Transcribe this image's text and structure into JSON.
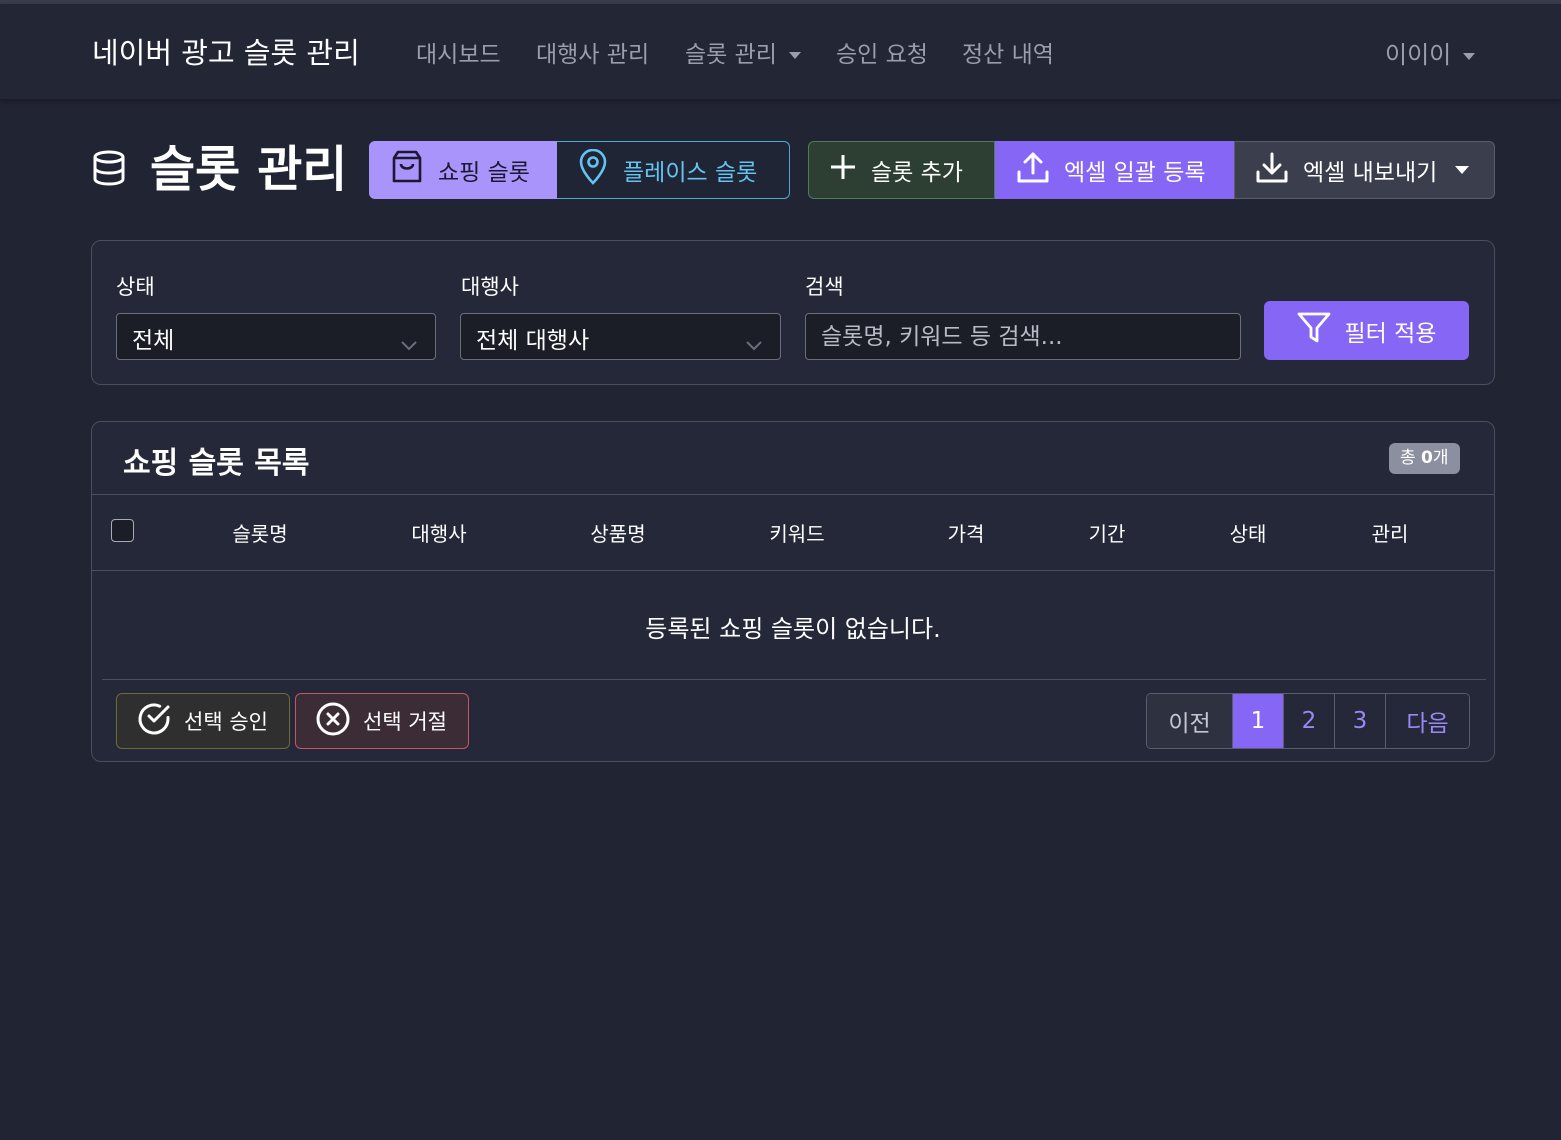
{
  "navbar": {
    "brand": "네이버 광고 슬롯 관리",
    "items": [
      "대시보드",
      "대행사 관리",
      "슬롯 관리",
      "승인 요청",
      "정산 내역"
    ],
    "user": "이이이"
  },
  "page": {
    "title": "슬롯 관리",
    "tabs": {
      "shopping": "쇼핑 슬롯",
      "place": "플레이스 슬롯"
    },
    "actions": {
      "add": "슬롯 추가",
      "excel_upload": "엑셀 일괄 등록",
      "excel_export": "엑셀 내보내기"
    }
  },
  "filters": {
    "status_label": "상태",
    "status_value": "전체",
    "agency_label": "대행사",
    "agency_value": "전체 대행사",
    "search_label": "검색",
    "search_placeholder": "슬롯명, 키워드 등 검색...",
    "apply": "필터 적용"
  },
  "list": {
    "title": "쇼핑 슬롯 목록",
    "count_prefix": "총 ",
    "count_value": "0",
    "count_suffix": "개",
    "columns": [
      "슬롯명",
      "대행사",
      "상품명",
      "키워드",
      "가격",
      "기간",
      "상태",
      "관리"
    ],
    "empty_message": "등록된 쇼핑 슬롯이 없습니다.",
    "bulk_approve": "선택 승인",
    "bulk_reject": "선택 거절"
  },
  "pagination": {
    "prev": "이전",
    "pages": [
      "1",
      "2",
      "3"
    ],
    "current": "1",
    "next": "다음"
  },
  "colors": {
    "background": "#212433",
    "primary": "#8667f5",
    "shopping_tab": "#a994fc",
    "place_tab": "#64c4ef",
    "approve_border": "#6d6a3b",
    "reject_border": "#c15863"
  },
  "icons": {
    "title": "database-icon",
    "shopping": "shopping-bag-icon",
    "place": "map-pin-icon",
    "add": "plus-icon",
    "upload": "upload-icon",
    "download": "download-icon",
    "filter": "filter-icon",
    "approve": "check-circle-icon",
    "reject": "x-circle-icon"
  }
}
